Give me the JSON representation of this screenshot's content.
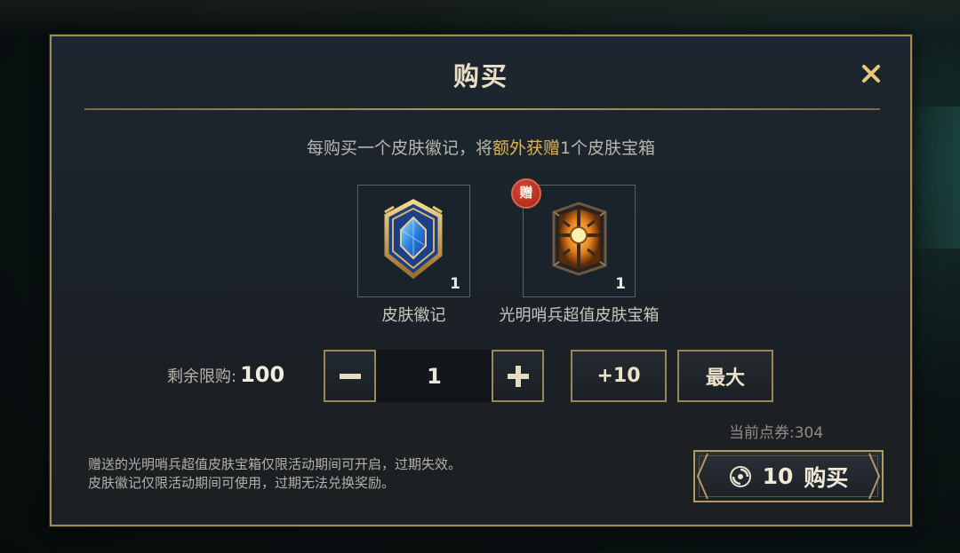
{
  "dialog": {
    "title": "购买",
    "promo": {
      "prefix": "每购买一个皮肤徽记，将",
      "highlight": "额外获赠",
      "suffix": "1个皮肤宝箱"
    },
    "items": [
      {
        "label": "皮肤徽记",
        "count": "1",
        "icon": "skin-emblem-icon"
      },
      {
        "label": "光明哨兵超值皮肤宝箱",
        "count": "1",
        "icon": "treasure-chest-icon",
        "badge": "赠"
      }
    ],
    "limit": {
      "label": "剩余限购:",
      "value": "100"
    },
    "quantity": {
      "value": "1",
      "minus_icon": "minus-icon",
      "plus_icon": "plus-icon"
    },
    "add_ten_label": "+10",
    "max_label": "最大",
    "balance": {
      "label": "当前点券:",
      "value": "304"
    },
    "notes": [
      "赠送的光明哨兵超值皮肤宝箱仅限活动期间可开启，过期失效。",
      "皮肤徽记仅限活动期间可使用，过期无法兑换奖励。"
    ],
    "buy": {
      "amount": "10",
      "label": "购买",
      "icon": "coupon-icon"
    }
  },
  "colors": {
    "accent_gold": "#b39a62",
    "highlight": "#e2b451",
    "badge_red": "#c0392b"
  }
}
